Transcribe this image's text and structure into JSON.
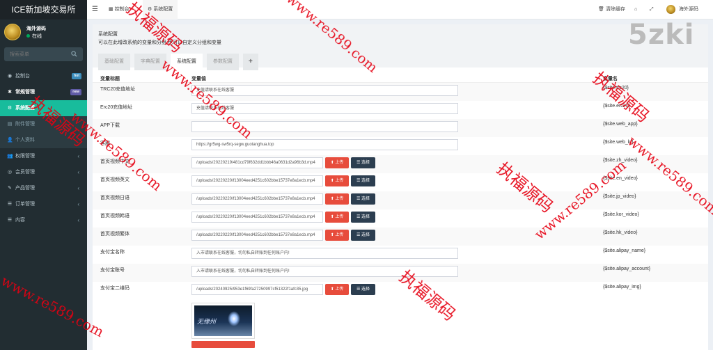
{
  "sidebar": {
    "logo": "ICE新加坡交易所",
    "user": {
      "name": "海外源码",
      "status": "在线"
    },
    "search_placeholder": "搜索菜单",
    "menu": [
      {
        "label": "控制台",
        "icon": "dashboard-icon",
        "badge": "hot",
        "badge_color": "#3c8dbc"
      },
      {
        "label": "常规管理",
        "icon": "gear-icon",
        "badge": "new",
        "badge_color": "#605ca8",
        "strong": true
      },
      {
        "label": "系统配置",
        "icon": "cog-icon",
        "active": true
      },
      {
        "label": "附件管理",
        "icon": "file-icon",
        "sub": true
      },
      {
        "label": "个人资料",
        "icon": "user-icon",
        "sub": true
      },
      {
        "label": "权限管理",
        "icon": "group-icon",
        "chevron": true
      },
      {
        "label": "会员管理",
        "icon": "user-circle-icon",
        "chevron": true
      },
      {
        "label": "产品管理",
        "icon": "pencil-icon",
        "chevron": true
      },
      {
        "label": "订单管理",
        "icon": "list-icon",
        "chevron": true
      },
      {
        "label": "内容",
        "icon": "list-icon",
        "chevron": true
      }
    ]
  },
  "topbar": {
    "breadcrumb_home": "控制台",
    "breadcrumb_current": "系统配置",
    "clear_cache": "清除缓存",
    "user_name": "海外源码"
  },
  "panel": {
    "title": "系统配置",
    "description": "可以在此增改系统的变量和分组,也可以自定义分组和变量",
    "tabs": [
      "基础配置",
      "字典配置",
      "系统配置",
      "参数配置"
    ],
    "active_tab": 2,
    "plus_tab": "+"
  },
  "table": {
    "headers": {
      "title": "变量标题",
      "value": "变量值",
      "name": "变量名"
    },
    "upload_label": "上传",
    "select_label": "选择",
    "rows": [
      {
        "title": "TRC20充值地址",
        "value": "充值请联系在线客服",
        "name": "{$site.trc20}",
        "type": "text"
      },
      {
        "title": "Erc20充值地址",
        "value": "充值请联系在线客服",
        "name": "{$site.erc20}",
        "type": "text"
      },
      {
        "title": "APP下载",
        "value": "",
        "name": "{$site.web_app}",
        "type": "text"
      },
      {
        "title": "客服",
        "value": "https://gr5wg-sw5rq-segw.guotanghua.top",
        "name": "{$site.web_kf}",
        "type": "text"
      },
      {
        "title": "首页视频中文",
        "value": "/uploads/20220219/481cd79f632dd1bbb46a0631d2a96b3d.mp4",
        "name": "{$site.zh_video}",
        "type": "file"
      },
      {
        "title": "首页视频英文",
        "value": "/uploads/20220220/f13004eed4251c602bbe15737e8a1ecb.mp4",
        "name": "{$site.en_video}",
        "type": "file"
      },
      {
        "title": "首页视频日语",
        "value": "/uploads/20220220/f13004eed4251c602bbe15737e8a1ecb.mp4",
        "name": "{$site.jp_video}",
        "type": "file"
      },
      {
        "title": "首页视频韩语",
        "value": "/uploads/20220220/f13004eed4251c602bbe15737e8a1ecb.mp4",
        "name": "{$site.kor_video}",
        "type": "file"
      },
      {
        "title": "首页视频繁体",
        "value": "/uploads/20220220/f13004eed4251c602bbe15737e8a1ecb.mp4",
        "name": "{$site.hk_video}",
        "type": "file"
      },
      {
        "title": "支付宝名称",
        "value": "入市请联系在线客服，切勿私自转账到任何账户内!",
        "name": "{$site.alipay_name}",
        "type": "text"
      },
      {
        "title": "支付宝账号",
        "value": "入市请联系在线客服，切勿私自转账到任何账户内!",
        "name": "{$site.alipay_account}",
        "type": "text"
      },
      {
        "title": "支付宝二维码",
        "value": "/uploads/20240925/953e1f69fa27250997cf51322f1afc35.jpg",
        "name": "{$site.alipay_img}",
        "type": "file"
      }
    ],
    "preview_caption": "无缘州"
  },
  "watermarks": {
    "brand": "5zki",
    "url": "www.re589.com",
    "cn": "执福源码"
  },
  "colors": {
    "sidebar_bg": "#222d32",
    "active": "#18bc9c",
    "upload": "#e74c3c",
    "select": "#2c3e50",
    "watermark": "#e60012"
  }
}
